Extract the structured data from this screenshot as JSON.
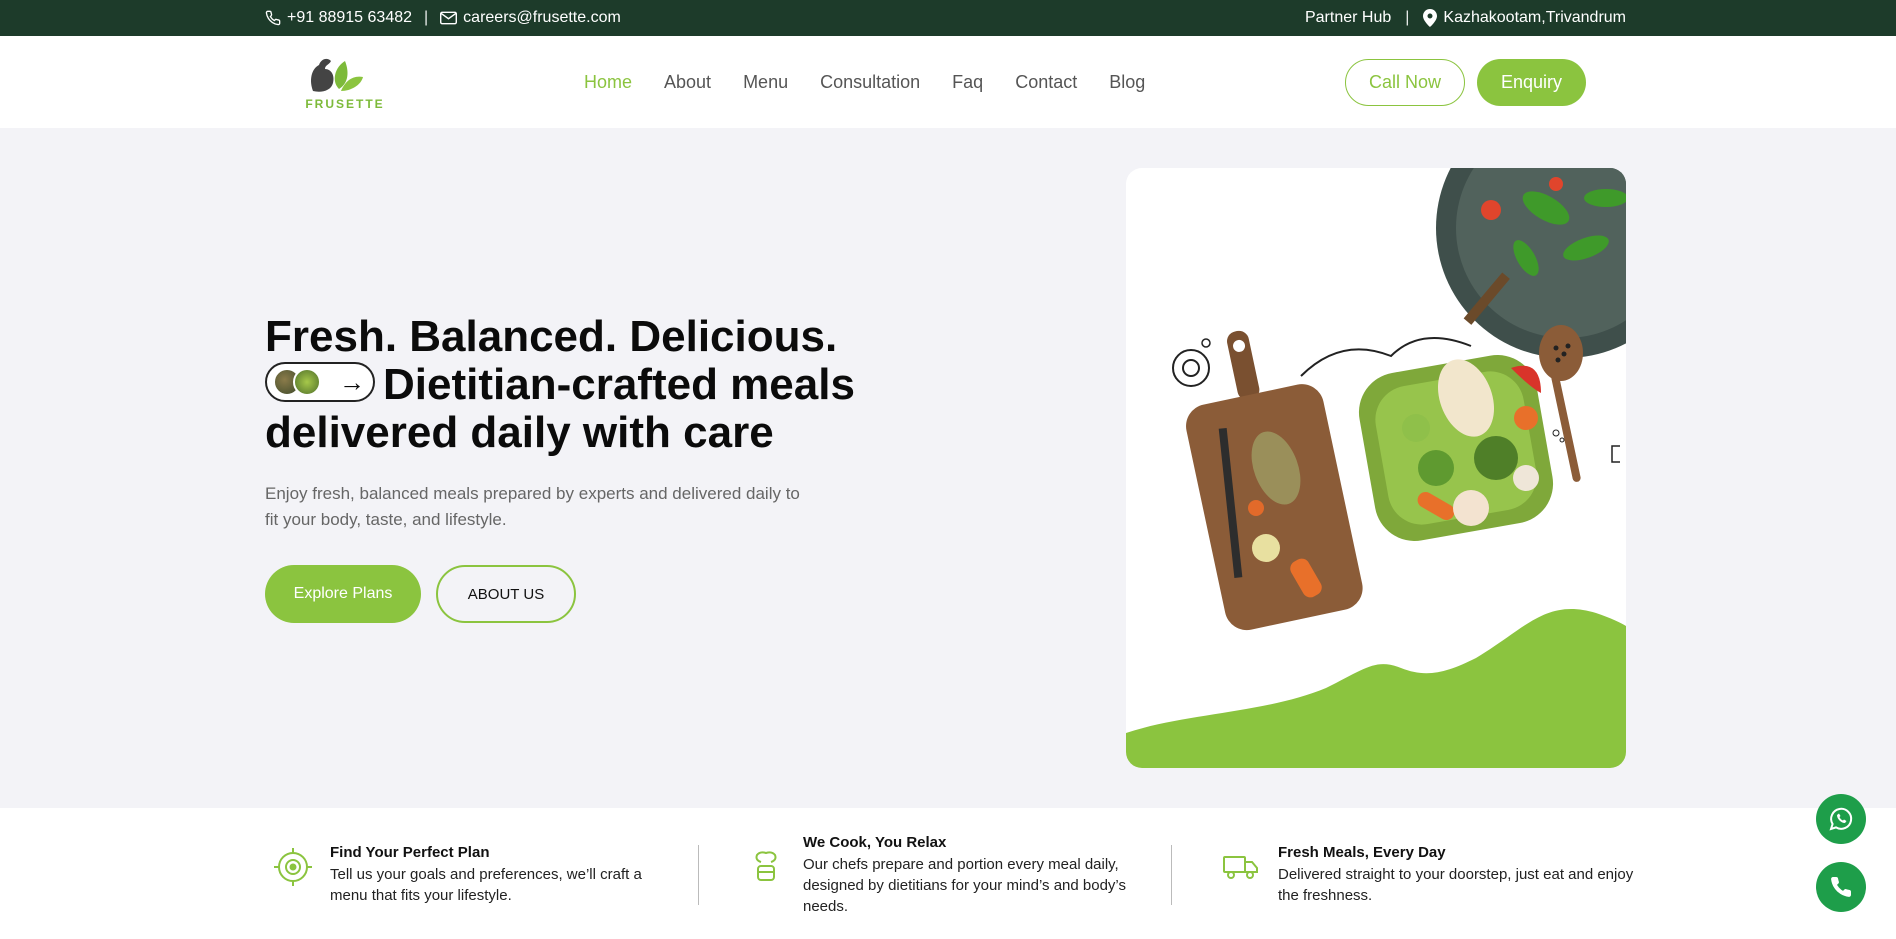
{
  "topbar": {
    "phone": "+91 88915 63482",
    "email": "careers@frusette.com",
    "partner": "Partner Hub",
    "location": "Kazhakootam,Trivandrum"
  },
  "header": {
    "logo_text": "FRUSETTE",
    "nav": [
      "Home",
      "About",
      "Menu",
      "Consultation",
      "Faq",
      "Contact",
      "Blog"
    ],
    "call_label": "Call Now",
    "enquiry_label": "Enquiry"
  },
  "hero": {
    "title_line1": "Fresh. Balanced. Delicious.",
    "title_line2": "Dietitian-crafted meals",
    "title_line3": "delivered daily with care",
    "pill_arrow": "→",
    "subtitle": "Enjoy fresh, balanced meals prepared by experts and delivered daily to fit your body, taste, and lifestyle.",
    "explore_label": "Explore Plans",
    "about_label": "ABOUT US"
  },
  "features": [
    {
      "title": "Find Your Perfect Plan",
      "text": "Tell us your goals and preferences, we’ll craft a menu that fits your lifestyle.",
      "icon": "target-icon"
    },
    {
      "title": "We Cook, You Relax",
      "text": "Our chefs prepare and portion every meal daily, designed by dietitians for your mind’s and body’s needs.",
      "icon": "chef-icon"
    },
    {
      "title": "Fresh Meals, Every Day",
      "text": "Delivered straight to your doorstep, just eat and enjoy the freshness.",
      "icon": "truck-icon"
    }
  ],
  "colors": {
    "brand_green": "#8bc43f",
    "topbar": "#1d3b2a",
    "whatsapp": "#1e9e4a"
  }
}
